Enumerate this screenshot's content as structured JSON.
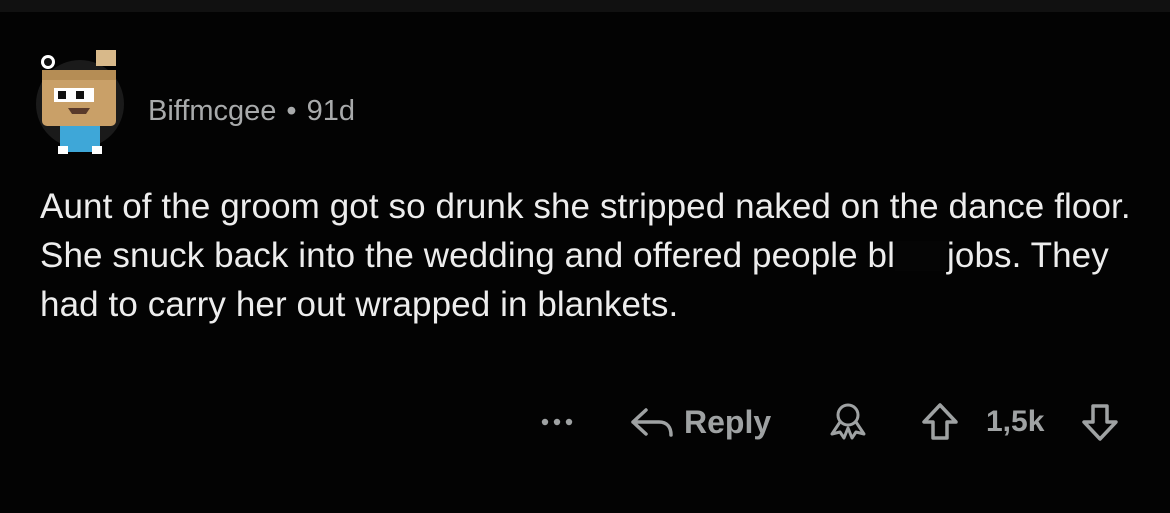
{
  "comment": {
    "author": "Biffmcgee",
    "separator": "•",
    "age": "91d",
    "text_before_censor": "Aunt of the groom got so drunk she stripped naked on the dance floor. She snuck back into the wedding and offered people bl",
    "text_after_censor": "jobs. They had to carry her out wrapped in blankets."
  },
  "actions": {
    "reply_label": "Reply",
    "vote_count": "1,5k",
    "icons": [
      "more-icon",
      "reply-arrow-icon",
      "award-icon",
      "upvote-icon",
      "downvote-icon"
    ]
  },
  "colors": {
    "background": "#030303",
    "text": "#ededed",
    "muted": "#a8aaab"
  }
}
